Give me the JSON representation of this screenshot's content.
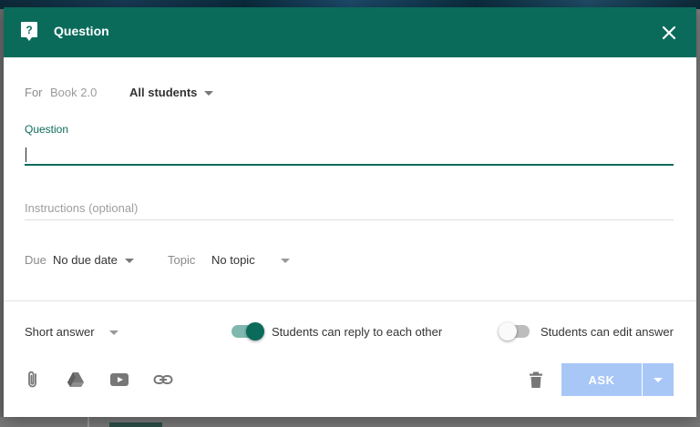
{
  "dialog": {
    "title": "Question",
    "close_icon": "close-icon",
    "header_icon": "question-mark-icon"
  },
  "for_row": {
    "label": "For",
    "course": "Book 2.0",
    "students": "All students"
  },
  "question": {
    "label": "Question",
    "value": ""
  },
  "instructions": {
    "placeholder": "Instructions (optional)"
  },
  "due": {
    "label": "Due",
    "value": "No due date"
  },
  "topic": {
    "label": "Topic",
    "value": "No topic"
  },
  "answer_type": {
    "value": "Short answer"
  },
  "toggles": {
    "reply": {
      "label": "Students can reply to each other",
      "on": true
    },
    "edit": {
      "label": "Students can edit answer",
      "on": false
    }
  },
  "attachments": {
    "icons": [
      "paperclip-icon",
      "google-drive-icon",
      "youtube-icon",
      "link-icon"
    ]
  },
  "actions": {
    "delete_icon": "trash-icon",
    "ask_label": "ASK"
  },
  "colors": {
    "header": "#0b6b5b",
    "accent": "#0b6b5b",
    "ask_button": "#a8c7f7"
  }
}
